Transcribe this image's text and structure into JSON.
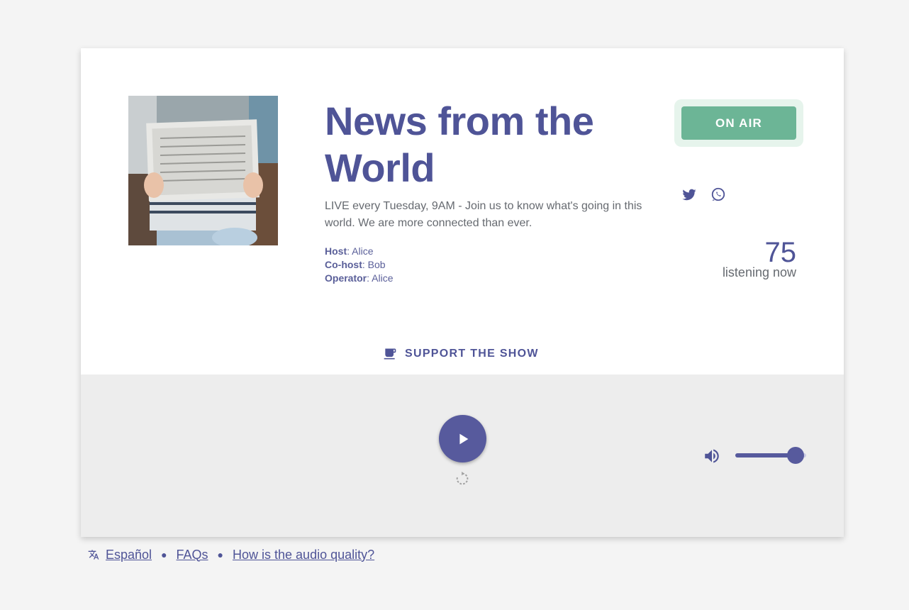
{
  "show": {
    "title": "News from the World",
    "description": "LIVE every Tuesday, 9AM - Join us to know what's going in this world. We are more connected than ever.",
    "credits": [
      {
        "role": "Host",
        "name": "Alice"
      },
      {
        "role": "Co-host",
        "name": "Bob"
      },
      {
        "role": "Operator",
        "name": "Alice"
      }
    ],
    "cover_image": "person-reading-newspaper"
  },
  "status": {
    "label": "ON AIR",
    "color": "#6cb596"
  },
  "social": {
    "icons": [
      "twitter-icon",
      "whatsapp-icon"
    ]
  },
  "listeners": {
    "count": "75",
    "label": "listening now"
  },
  "support": {
    "label": "SUPPORT THE SHOW",
    "icon": "coffee-cup-icon"
  },
  "player": {
    "play_icon": "play-icon",
    "reload_icon": "reload-icon",
    "volume_icon": "volume-icon",
    "volume_level": 0.85
  },
  "footer": {
    "language_icon": "translate-icon",
    "links": [
      "Español",
      "FAQs",
      "How is the audio quality?"
    ]
  },
  "colors": {
    "accent": "#4f5497",
    "player_bg": "#ededed",
    "page_bg": "#f4f4f4"
  }
}
